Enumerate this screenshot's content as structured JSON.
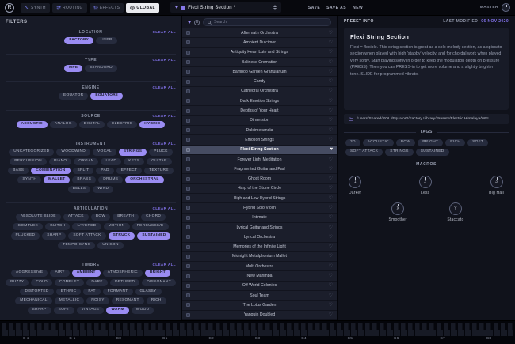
{
  "topbar": {
    "logo": "R",
    "tabs": [
      "SYNTH",
      "ROUTING",
      "EFFECTS",
      "GLOBAL"
    ],
    "preset_name": "Flexi String Section *",
    "actions": {
      "save": "SAVE",
      "save_as": "SAVE AS",
      "new": "NEW"
    },
    "master_label": "MASTER"
  },
  "filters": {
    "title": "FILTERS",
    "clear_all": "CLEAR ALL",
    "sections": [
      {
        "name": "LOCATION",
        "chips": [
          {
            "label": "FACTORY",
            "selected": true
          },
          {
            "label": "USER",
            "selected": false
          }
        ]
      },
      {
        "name": "TYPE",
        "chips": [
          {
            "label": "MPE",
            "selected": true
          },
          {
            "label": "STANDARD",
            "selected": false
          }
        ]
      },
      {
        "name": "ENGINE",
        "chips": [
          {
            "label": "EQUATOR",
            "selected": false
          },
          {
            "label": "EQUATOR2",
            "selected": true
          }
        ]
      },
      {
        "name": "SOURCE",
        "chips": [
          {
            "label": "ACOUSTIC",
            "selected": true
          },
          {
            "label": "ANALOG",
            "selected": false
          },
          {
            "label": "DIGITAL",
            "selected": false
          },
          {
            "label": "ELECTRIC",
            "selected": false
          },
          {
            "label": "HYBRID",
            "selected": true
          }
        ]
      },
      {
        "name": "INSTRUMENT",
        "chips": [
          {
            "label": "UNCATEGORIZED",
            "selected": false
          },
          {
            "label": "WOODWIND",
            "selected": false
          },
          {
            "label": "VOCAL",
            "selected": false
          },
          {
            "label": "STRINGS",
            "selected": true
          },
          {
            "label": "PLUCK",
            "selected": false
          },
          {
            "label": "PERCUSSION",
            "selected": false
          },
          {
            "label": "PIANO",
            "selected": false
          },
          {
            "label": "ORGAN",
            "selected": false
          },
          {
            "label": "LEAD",
            "selected": false
          },
          {
            "label": "KEYS",
            "selected": false
          },
          {
            "label": "GUITAR",
            "selected": false
          },
          {
            "label": "BASS",
            "selected": false
          },
          {
            "label": "COMBINATION",
            "selected": true
          },
          {
            "label": "SPLIT",
            "selected": false
          },
          {
            "label": "PAD",
            "selected": false
          },
          {
            "label": "EFFECT",
            "selected": false
          },
          {
            "label": "TEXTURE",
            "selected": false
          },
          {
            "label": "SYNTH",
            "selected": false
          },
          {
            "label": "MALLET",
            "selected": true
          },
          {
            "label": "BRASS",
            "selected": false
          },
          {
            "label": "DRUMS",
            "selected": false
          },
          {
            "label": "ORCHESTRAL",
            "selected": true
          },
          {
            "label": "BELLS",
            "selected": false
          },
          {
            "label": "WIND",
            "selected": false
          }
        ]
      },
      {
        "name": "ARTICULATION",
        "chips": [
          {
            "label": "ABSOLUTE SLIDE",
            "selected": false
          },
          {
            "label": "ATTACK",
            "selected": false
          },
          {
            "label": "BOW",
            "selected": false
          },
          {
            "label": "BREATH",
            "selected": false
          },
          {
            "label": "CHORD",
            "selected": false
          },
          {
            "label": "COMPLEX",
            "selected": false
          },
          {
            "label": "GLITCH",
            "selected": false
          },
          {
            "label": "LAYERED",
            "selected": false
          },
          {
            "label": "MOTION",
            "selected": false
          },
          {
            "label": "PERCUSSIVE",
            "selected": false
          },
          {
            "label": "PLUCKED",
            "selected": false
          },
          {
            "label": "SHARP",
            "selected": false
          },
          {
            "label": "SOFT ATTACK",
            "selected": false
          },
          {
            "label": "STRUCK",
            "selected": true
          },
          {
            "label": "SUSTAINED",
            "selected": true
          },
          {
            "label": "TEMPO-SYNC",
            "selected": false
          },
          {
            "label": "UNISON",
            "selected": false
          }
        ]
      },
      {
        "name": "TIMBRE",
        "chips": [
          {
            "label": "AGGRESSIVE",
            "selected": false
          },
          {
            "label": "AIRY",
            "selected": false
          },
          {
            "label": "AMBIENT",
            "selected": true
          },
          {
            "label": "ATMOSPHERIC",
            "selected": false
          },
          {
            "label": "BRIGHT",
            "selected": true
          },
          {
            "label": "BUZZY",
            "selected": false
          },
          {
            "label": "COLD",
            "selected": false
          },
          {
            "label": "COMPLEX",
            "selected": false
          },
          {
            "label": "DARK",
            "selected": false
          },
          {
            "label": "DETUNED",
            "selected": false
          },
          {
            "label": "DISSONANT",
            "selected": false
          },
          {
            "label": "DISTORTED",
            "selected": false
          },
          {
            "label": "ETHNIC",
            "selected": false
          },
          {
            "label": "FAT",
            "selected": false
          },
          {
            "label": "FORMANT",
            "selected": false
          },
          {
            "label": "GLASSY",
            "selected": false
          },
          {
            "label": "MECHANICAL",
            "selected": false
          },
          {
            "label": "METALLIC",
            "selected": false
          },
          {
            "label": "NOISY",
            "selected": false
          },
          {
            "label": "RESONANT",
            "selected": false
          },
          {
            "label": "RICH",
            "selected": false
          },
          {
            "label": "SHARP",
            "selected": false
          },
          {
            "label": "SOFT",
            "selected": false
          },
          {
            "label": "VINTAGE",
            "selected": false
          },
          {
            "label": "WARM",
            "selected": true
          },
          {
            "label": "WOOD",
            "selected": false
          }
        ]
      }
    ]
  },
  "preset_list": {
    "search_placeholder": "Search",
    "items": [
      {
        "name": "Aftermath Orchestra",
        "selected": false
      },
      {
        "name": "Ambient Dulcimer",
        "selected": false
      },
      {
        "name": "Antiquity Heart Lute and Strings",
        "selected": false
      },
      {
        "name": "Balinese Cremation",
        "selected": false
      },
      {
        "name": "Bamboo Garden Granularium",
        "selected": false
      },
      {
        "name": "Candy",
        "selected": false
      },
      {
        "name": "Cathedral Orchestra",
        "selected": false
      },
      {
        "name": "Dark Emotion Strings",
        "selected": false
      },
      {
        "name": "Depths of Your Heart",
        "selected": false
      },
      {
        "name": "Dimension",
        "selected": false
      },
      {
        "name": "Dulcimexandia",
        "selected": false
      },
      {
        "name": "Emotion Strings",
        "selected": false
      },
      {
        "name": "Flexi String Section",
        "selected": true
      },
      {
        "name": "Forever Light Meditation",
        "selected": false
      },
      {
        "name": "Fragmented Guitar and Pad",
        "selected": false
      },
      {
        "name": "Ghost Room",
        "selected": false
      },
      {
        "name": "Harp of the Stone Circle",
        "selected": false
      },
      {
        "name": "High and Low Hybrid Strings",
        "selected": false
      },
      {
        "name": "Hybrid Solo Violin",
        "selected": false
      },
      {
        "name": "Intimate",
        "selected": false
      },
      {
        "name": "Lyrical Guitar and Strings",
        "selected": false
      },
      {
        "name": "Lyrical Orchestra",
        "selected": false
      },
      {
        "name": "Memories of the Infinite Light",
        "selected": false
      },
      {
        "name": "Midnight Metalphonium Mallet",
        "selected": false
      },
      {
        "name": "Multi Orchestra",
        "selected": false
      },
      {
        "name": "New Marimba",
        "selected": false
      },
      {
        "name": "Off World Colonies",
        "selected": false
      },
      {
        "name": "Soul Team",
        "selected": false
      },
      {
        "name": "The Lotus Garden",
        "selected": false
      },
      {
        "name": "Yanguin Doubled",
        "selected": false
      }
    ]
  },
  "preset_info": {
    "header": "PRESET INFO",
    "last_modified_label": "LAST MODIFIED",
    "last_modified": "06 NOV 2020",
    "title": "Flexi String Section",
    "description": "Flexi = flexible. This string section is great as a solo melody section, as a spiccato section when played with high 'stabby' velocity, and for chordal work when played very softly. Start playing softly in order to keep the modulation depth on pressure (PRESS). Then you can PRESS-in to get more volume and a slightly brighter tone. SLIDE for programmed vibrato.",
    "path": "/Users/Shared/ROLI/Equator2/Factory Library/Presets/Electric Himalaya/WFI",
    "tags_label": "TAGS",
    "tags": [
      "3D",
      "ACOUSTIC",
      "BOW",
      "BRIGHT",
      "RICH",
      "SOFT",
      "SOFT ATTACK",
      "STRINGS",
      "SUSTAINED"
    ],
    "macros_label": "MACROS",
    "macros": [
      {
        "id": "1",
        "label": "Darker"
      },
      {
        "id": "2",
        "label": "Less"
      },
      {
        "id": "3",
        "label": "Big Hall"
      },
      {
        "id": "X",
        "label": "Smoother"
      },
      {
        "id": "Y",
        "label": "Staccato"
      }
    ]
  },
  "keyboard": {
    "octaves": [
      "C-2",
      "C-1",
      "C0",
      "C1",
      "C2",
      "C3",
      "C4",
      "C5",
      "C6",
      "C7",
      "C8"
    ]
  },
  "colors": {
    "accent": "#9a8cf2",
    "link": "#8373ec",
    "date": "#8373ec",
    "selected_row": "#464c62"
  }
}
